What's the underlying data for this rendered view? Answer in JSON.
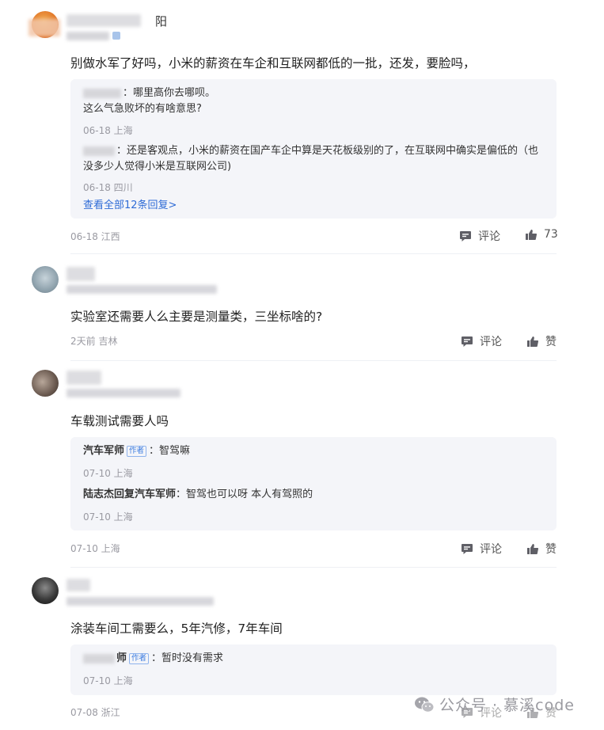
{
  "comments": [
    {
      "name_tail": "阳",
      "content": "别做水军了好吗，小米的薪资在车企和互联网都低的一批，还发，要脸吗，",
      "replies": [
        {
          "text": "：哪里高你去哪呗。",
          "text2": "这么气急败坏的有啥意思?",
          "meta": "06-18 上海"
        },
        {
          "text": "：还是客观点，小米的薪资在国产车企中算是天花板级别的了，在互联网中确实是偏低的（也",
          "text2": "没多少人觉得小米是互联网公司)",
          "meta": "06-18 四川"
        }
      ],
      "more_replies": "查看全部12条回复>",
      "meta": "06-18 江西",
      "comment_label": "评论",
      "like_label": "73"
    },
    {
      "content": "实验室还需要人么主要是测量类，三坐标啥的?",
      "meta": "2天前 吉林",
      "comment_label": "评论",
      "like_label": "赞"
    },
    {
      "content": "车载测试需要人吗",
      "replies": [
        {
          "who": "汽车军师",
          "tag": "作者",
          "text": "：智驾嘛",
          "meta": "07-10 上海"
        },
        {
          "who": "陆志杰回复汽车军师",
          "text": "：智驾也可以呀 本人有驾照的",
          "meta": "07-10 上海"
        }
      ],
      "meta": "07-10 上海",
      "comment_label": "评论",
      "like_label": "赞"
    },
    {
      "content": "涂装车间工需要么，5年汽修，7年车间",
      "replies": [
        {
          "who_tail": "师",
          "tag": "作者",
          "text": "：暂时没有需求",
          "meta": "07-10 上海"
        }
      ],
      "meta": "07-08 浙江",
      "comment_label": "评论",
      "like_label": "赞"
    }
  ],
  "watermark": "公众号 · 慕溪code",
  "colors": {
    "link": "#2e6bd6",
    "reply_bg": "#f4f5f9",
    "meta": "#9a9aa2"
  }
}
